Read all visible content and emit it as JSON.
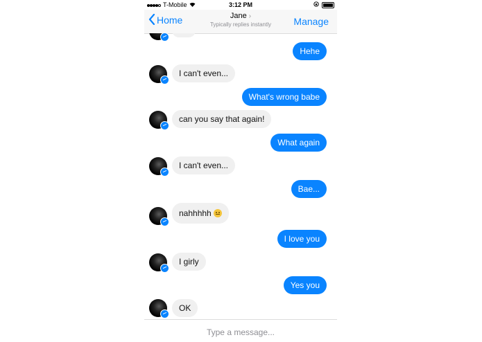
{
  "status": {
    "carrier": "T-Mobile",
    "time": "3:12 PM"
  },
  "nav": {
    "back_label": "Home",
    "contact_name": "Jane",
    "subtitle": "Typically replies instantly",
    "manage_label": "Manage"
  },
  "messages": [
    {
      "from": "me",
      "text": "Hehe"
    },
    {
      "from": "them",
      "text": "I can't even..."
    },
    {
      "from": "me",
      "text": "What's wrong babe"
    },
    {
      "from": "them",
      "text": "can you say that again!"
    },
    {
      "from": "me",
      "text": "What again"
    },
    {
      "from": "them",
      "text": "I can't even..."
    },
    {
      "from": "me",
      "text": "Bae..."
    },
    {
      "from": "them",
      "text": "nahhhhh",
      "emoji": "slightly-smiling-face"
    },
    {
      "from": "me",
      "text": "I love you"
    },
    {
      "from": "them",
      "text": "I girly"
    },
    {
      "from": "me",
      "text": "Yes you"
    },
    {
      "from": "them",
      "text": "OK"
    }
  ],
  "composer": {
    "placeholder": "Type a message..."
  },
  "colors": {
    "outgoing_bubble": "#0a84ff",
    "incoming_bubble": "#f0f0f0",
    "accent": "#0a84ff"
  }
}
